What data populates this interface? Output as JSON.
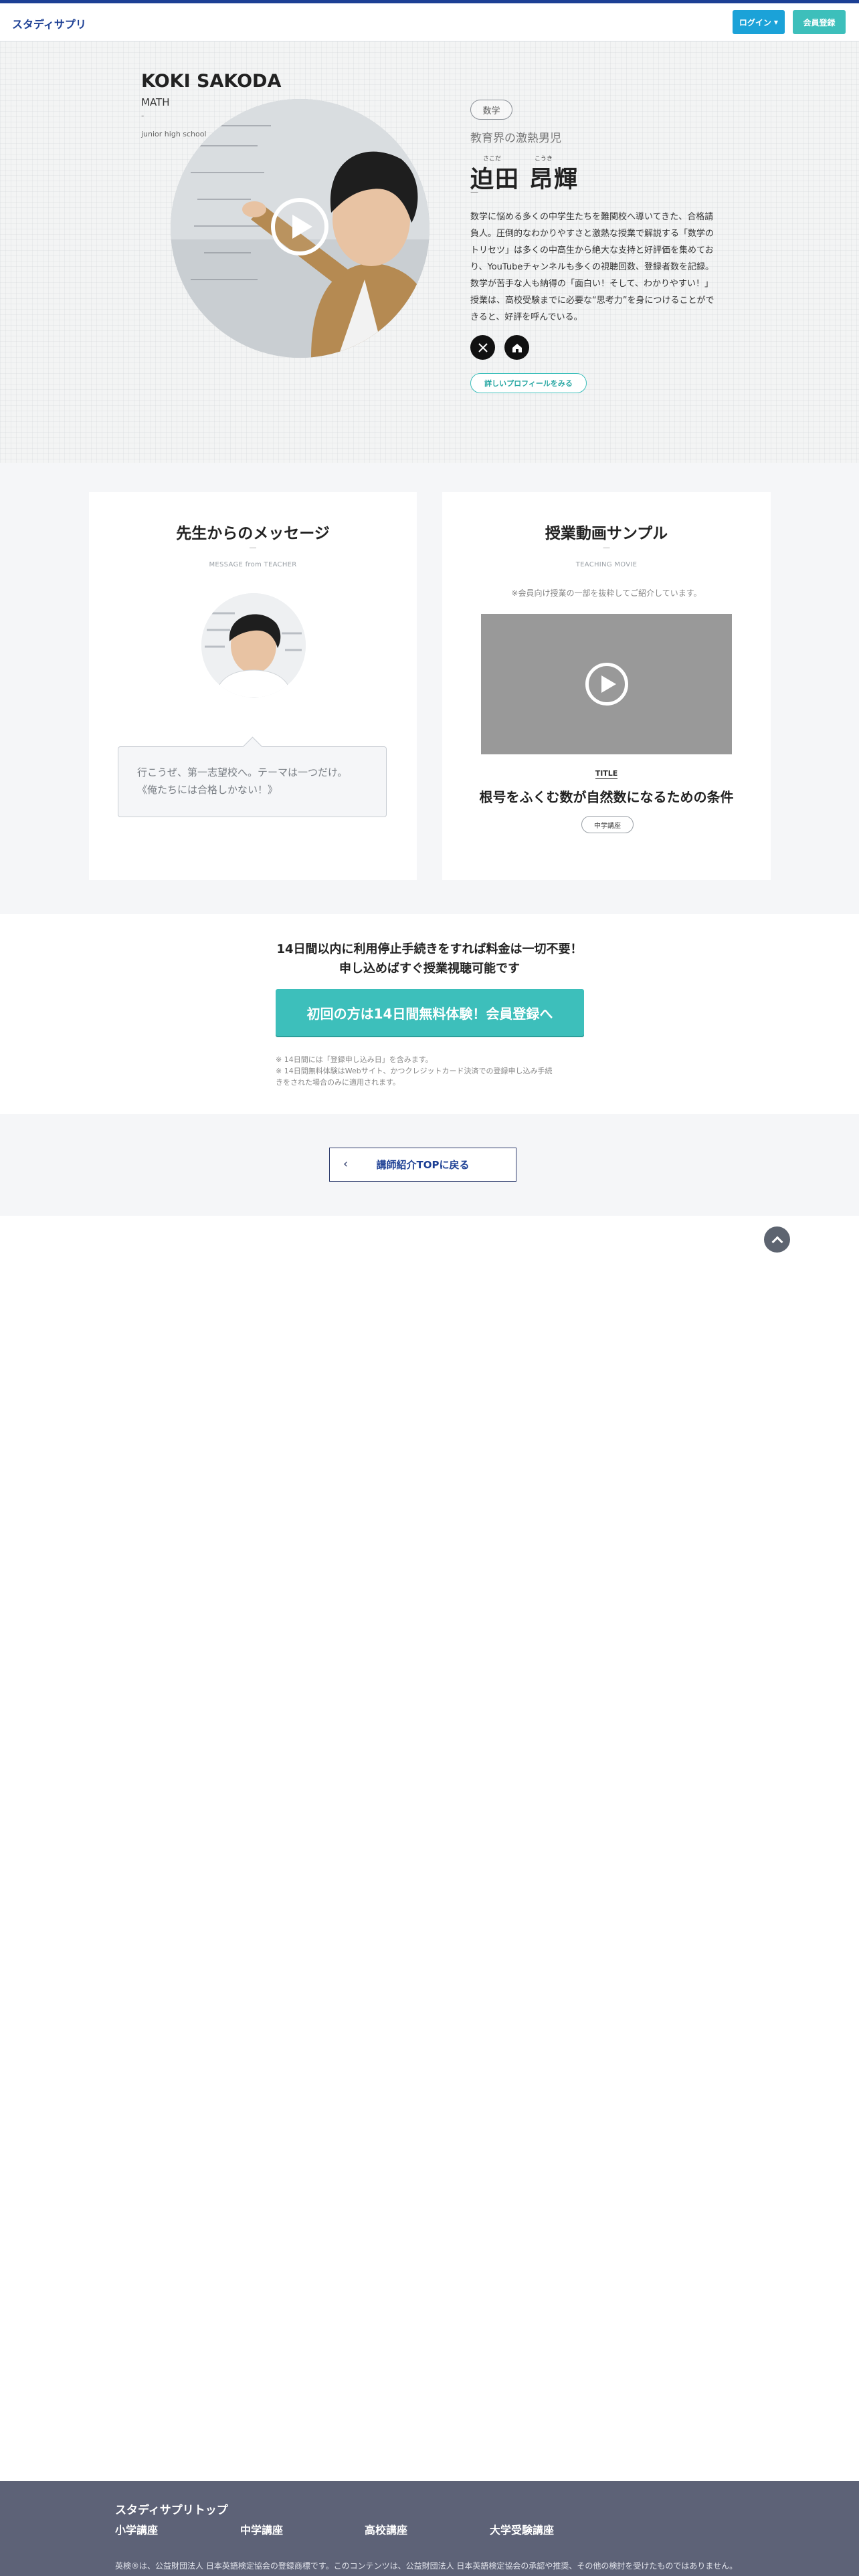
{
  "header": {
    "logo": "スタディサプリ",
    "login_label": "ログイン",
    "register_label": "会員登録"
  },
  "hero": {
    "name_en": "KOKI SAKODA",
    "subject_en": "MATH",
    "dash": "-",
    "level_en": "junior high school",
    "subject_tag": "数学",
    "catchphrase": "教育界の激熱男児",
    "ruby_family": "さこだ",
    "ruby_given": "こうき",
    "name_jp": "迫田 昂輝",
    "name_dash": "—",
    "bio": "数学に悩める多くの中学生たちを難関校へ導いてきた、合格請負人。圧倒的なわかりやすさと激熱な授業で解説する「数学のトリセツ」は多くの中高生から絶大な支持と好評価を集めており、YouTubeチャンネルも多くの視聴回数、登録者数を記録。数学が苦手な人も納得の「面白い！そして、わかりやすい！」授業は、高校受験までに必要な“思考力”を身につけることができると、好評を呼んでいる。",
    "profile_link": "詳しいプロフィールをみる",
    "sns_x_icon": "x-logo-icon",
    "sns_youtube_icon": "home-icon"
  },
  "message_card": {
    "title": "先生からのメッセージ",
    "dash": "—",
    "subtitle": "MESSAGE from TEACHER",
    "message_line1": "行こうぜ、第一志望校へ。テーマは一つだけ。",
    "message_line2": "《俺たちには合格しかない！》"
  },
  "video_card": {
    "title": "授業動画サンプル",
    "dash": "—",
    "subtitle": "TEACHING MOVIE",
    "note": "※会員向け授業の一部を抜粋してご紹介しています。",
    "title_label": "TITLE",
    "video_title": "根号をふくむ数が自然数になるための条件",
    "course_tag": "中学講座"
  },
  "cta": {
    "headline_line1": "14日間以内に利用停止手続きをすれば料金は一切不要！",
    "headline_line2": "申し込めばすぐ授業視聴可能です",
    "button": "初回の方は14日間無料体験！会員登録へ",
    "note_line1": "※ 14日間には「登録申し込み日」を含みます。",
    "note_line2": "※ 14日間無料体験はWebサイト、かつクレジットカード決済での登録申し込み手続",
    "note_line3": "きをされた場合のみに適用されます。"
  },
  "back": {
    "label": "講師紹介TOPに戻る"
  },
  "footer": {
    "top_link": "スタディサプリトップ",
    "links": [
      "小学講座",
      "中学講座",
      "高校講座",
      "大学受験講座"
    ],
    "note": "英検®は、公益財団法人 日本英語検定協会の登録商標です。このコンテンツは、公益財団法人 日本英語検定協会の承認や推奨、その他の検討を受けたものではありません。"
  }
}
